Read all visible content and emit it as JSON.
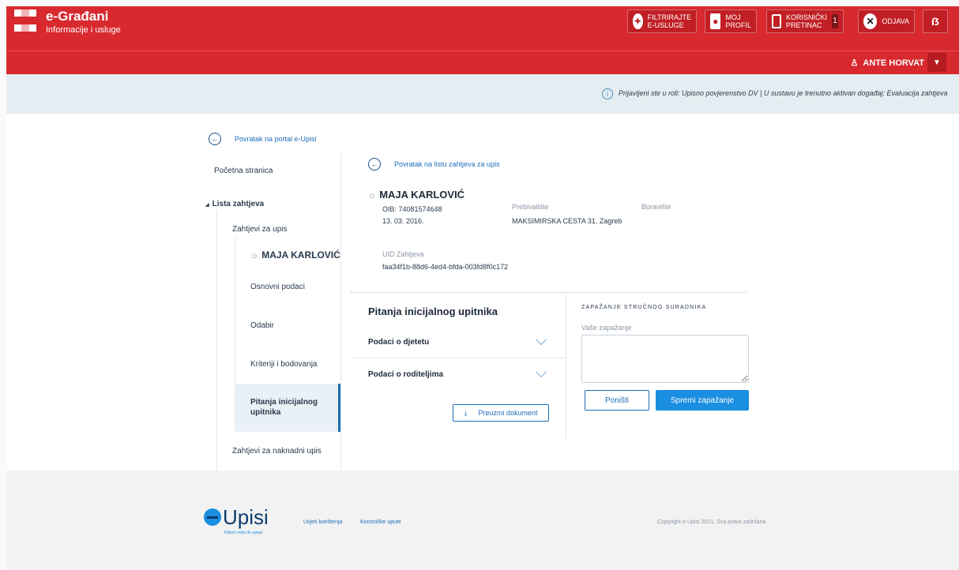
{
  "header": {
    "brand_title": "e-Građani",
    "brand_subtitle": "Informacije i usluge",
    "buttons": {
      "filter_line1": "FILTRIRAJTE",
      "filter_line2": "E-USLUGE",
      "profile_line1": "MOJ",
      "profile_line2": "PROFIL",
      "inbox_line1": "KORISNIČKI",
      "inbox_line2": "PRETINAC",
      "inbox_count": "1",
      "logout": "ODJAVA",
      "lang_glyph": "ẞ"
    },
    "user_name": "ANTE HORVAT"
  },
  "info": {
    "text": "Prijavljeni ste u roli: Upisno povjerenstvo DV | U sustavu je trenutno aktivan događaj: Evaluacija zahtjeva"
  },
  "sidebar": {
    "back_link": "Povratak na portal e-Upisi",
    "home": "Početna stranica",
    "list": "Lista zahtjeva",
    "requests": "Zahtjevi za upis",
    "child_name": "MAJA KARLOVIĆ",
    "items": [
      "Osnovni podaci",
      "Odabir",
      "Kriteriji i bodovanja",
      "Pitanja inicijalnog upitnika"
    ],
    "late_requests": "Zahtjevi za naknadni upis"
  },
  "main": {
    "back_link": "Povratak na listu zahtjeva za upis",
    "person_name": "MAJA KARLOVIĆ",
    "oib": "OIB: 74081574648",
    "dob": "13. 03. 2016.",
    "residence_label": "Prebivalište",
    "residence_value": "MAKSIMIRSKA CESTA 31, Zagreb",
    "stay_label": "Boravište",
    "uid_label": "UID Zahtjeva",
    "uid_value": "faa34f1b-88d6-4ed4-bfda-003fd8f0c172",
    "questionnaire_title": "Pitanja inicijalnog upitnika",
    "accordion": [
      "Podaci o djetetu",
      "Podaci o roditeljima"
    ],
    "download_label": "Preuzmi dokument",
    "observation_title": "ZAPAŽANJE STRUČNOG SURADNIKA",
    "observation_label": "Vaše zapažanje",
    "cancel_label": "Poništi",
    "save_label": "Spremi zapažanje"
  },
  "footer": {
    "logo_text": "Upisi",
    "logo_tagline": "Klikom miša do upisa!",
    "terms": "Uvjeti korištenja",
    "manual": "Korisničke upute",
    "copyright": "Copyright e-Upisi 2021. Sva prava zadržana"
  },
  "colors": {
    "brand_red": "#d8292f",
    "accent_blue": "#1a8ee0"
  }
}
